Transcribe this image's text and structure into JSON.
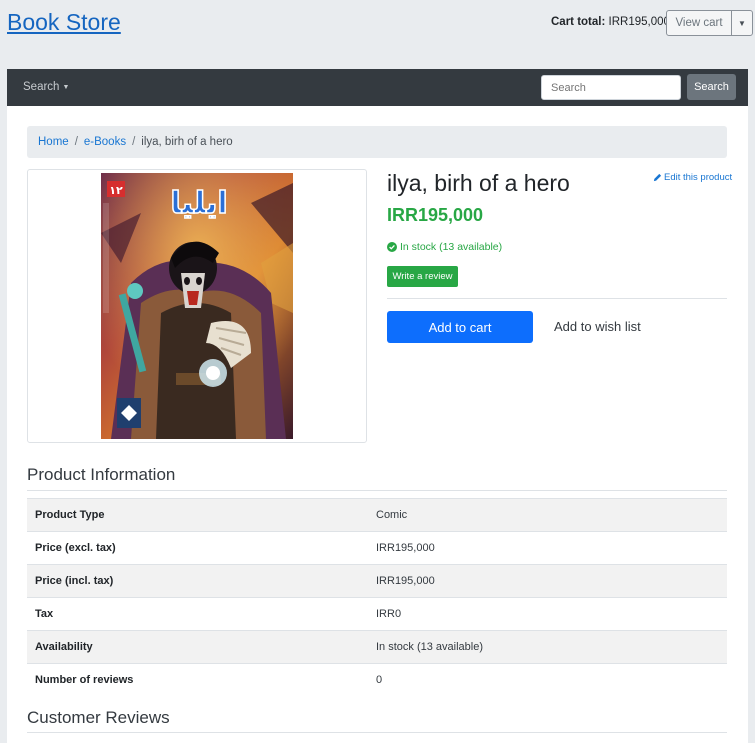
{
  "header": {
    "brand": "Book Store",
    "cart_total_label": "Cart total:",
    "cart_total_value": "IRR195,000",
    "view_cart_label": "View cart"
  },
  "navbar": {
    "search_menu_label": "Search",
    "search_placeholder": "Search",
    "search_button_label": "Search"
  },
  "breadcrumb": {
    "home": "Home",
    "category": "e-Books",
    "current": "ilya, birh of a hero"
  },
  "product": {
    "title": "ilya, birh of a hero",
    "edit_link": "Edit this product",
    "price": "IRR195,000",
    "stock": "In stock (13 available)",
    "write_review": "Write a review",
    "add_to_cart": "Add to cart",
    "add_to_wishlist": "Add to wish list",
    "cover_text": "ایلیا",
    "cover_number": "۱۲"
  },
  "info": {
    "title": "Product Information",
    "rows": [
      {
        "key": "Product Type",
        "value": "Comic"
      },
      {
        "key": "Price (excl. tax)",
        "value": "IRR195,000"
      },
      {
        "key": "Price (incl. tax)",
        "value": "IRR195,000"
      },
      {
        "key": "Tax",
        "value": "IRR0"
      },
      {
        "key": "Availability",
        "value": "In stock (13 available)"
      },
      {
        "key": "Number of reviews",
        "value": "0"
      }
    ]
  },
  "reviews": {
    "title": "Customer Reviews"
  },
  "colors": {
    "brand": "#1565c0",
    "navbar": "#343a40",
    "success": "#28a745",
    "primary": "#0d6efd",
    "link": "#1976d2"
  }
}
